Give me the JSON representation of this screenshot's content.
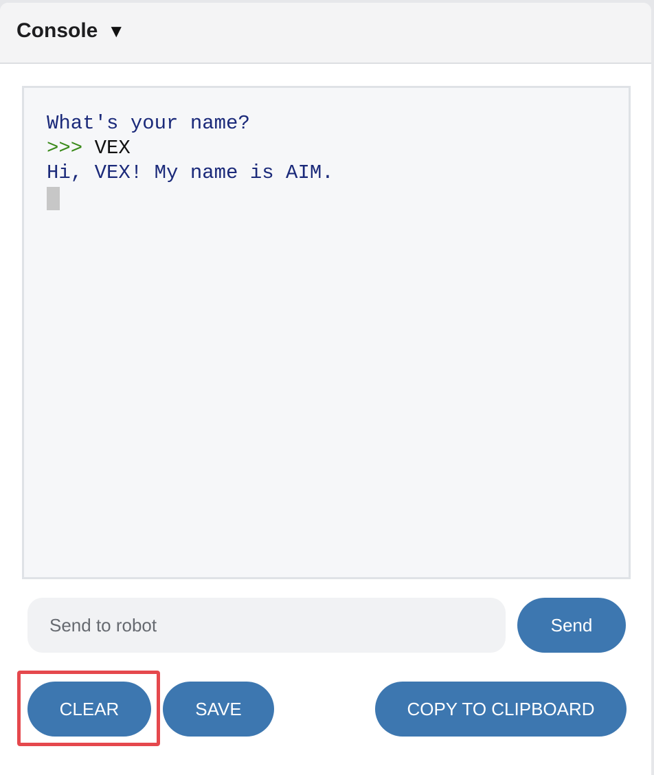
{
  "header": {
    "title": "Console",
    "toggle_icon": "caret-down-icon",
    "toggle_glyph": "▼"
  },
  "console": {
    "lines": [
      {
        "type": "output",
        "text": "What's your name?"
      },
      {
        "type": "input",
        "prompt": ">>>",
        "text": "VEX"
      },
      {
        "type": "output",
        "text": "Hi, VEX! My name is AIM."
      }
    ]
  },
  "send": {
    "placeholder": "Send to robot",
    "value": "",
    "button_label": "Send"
  },
  "actions": {
    "clear_label": "CLEAR",
    "save_label": "SAVE",
    "copy_label": "COPY TO CLIPBOARD"
  },
  "colors": {
    "button": "#3d77b0",
    "highlight": "#e5484d",
    "output_text": "#1b2a7a",
    "prompt_text": "#3a8a1a"
  }
}
